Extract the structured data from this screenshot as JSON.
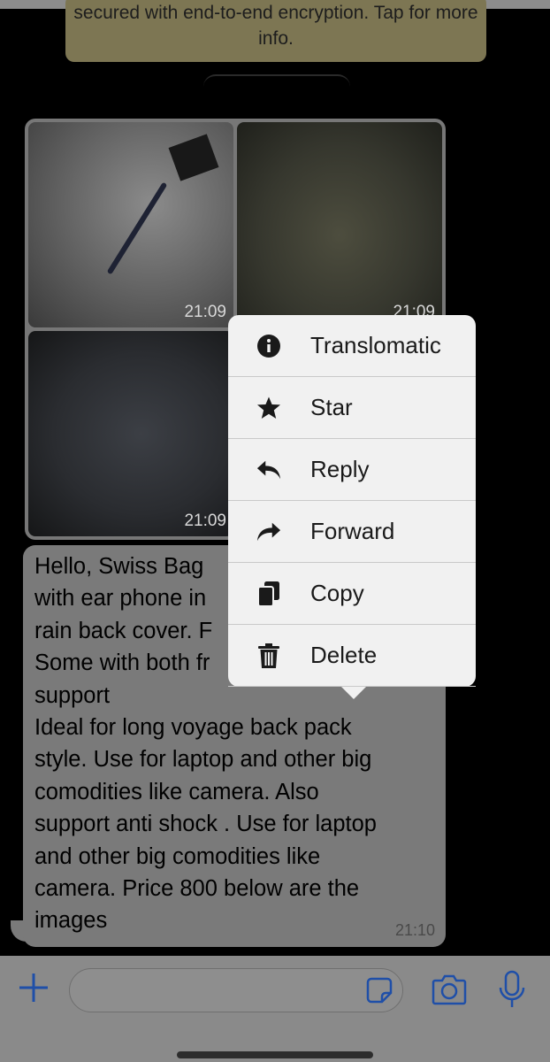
{
  "encryption_banner": {
    "text": "secured with end-to-end encryption. Tap for more info."
  },
  "images": [
    {
      "time": "21:09",
      "alt": "backpack-grey"
    },
    {
      "time": "21:09",
      "alt": "backpack-olive"
    },
    {
      "time": "21:09",
      "alt": "backpack-dark"
    }
  ],
  "message": {
    "text": "Hello,  Swiss Bag\nwith ear phone in\nrain back cover. F\nSome with both fr\nsupport\nIdeal for long voyage back pack\nstyle. Use for laptop and other big\ncomodities like camera. Also\nsupport anti shock . Use for laptop\nand other big comodities like\ncamera. Price 800 below are the\nimages",
    "time": "21:10"
  },
  "context_menu": {
    "items": [
      {
        "label": "Translomatic",
        "icon": "info-icon"
      },
      {
        "label": "Star",
        "icon": "star-icon"
      },
      {
        "label": "Reply",
        "icon": "reply-icon"
      },
      {
        "label": "Forward",
        "icon": "forward-icon"
      },
      {
        "label": "Copy",
        "icon": "copy-icon"
      },
      {
        "label": "Delete",
        "icon": "trash-icon"
      }
    ]
  },
  "input_bar": {
    "placeholder": ""
  },
  "colors": {
    "accent": "#1f4fa8",
    "menu_bg": "#f1f1f1",
    "bubble_dimmed": "#7a7a7a"
  }
}
